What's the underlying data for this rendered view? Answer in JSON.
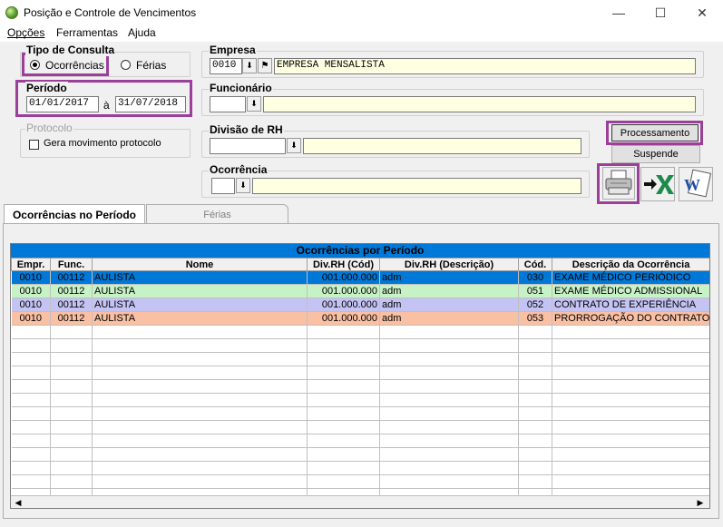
{
  "window": {
    "title": "Posição e Controle de Vencimentos"
  },
  "menu": {
    "items": [
      "Opções",
      "Ferramentas",
      "Ajuda"
    ]
  },
  "tipo_consulta": {
    "label": "Tipo de Consulta",
    "option1": "Ocorrências",
    "option2": "Férias",
    "selected": "Ocorrências"
  },
  "periodo": {
    "label": "Período",
    "from": "01/01/2017",
    "sep": "à",
    "to": "31/07/2018"
  },
  "protocolo": {
    "label": "Protocolo",
    "checkbox": "Gera movimento protocolo"
  },
  "empresa": {
    "label": "Empresa",
    "code": "0010",
    "name": "EMPRESA MENSALISTA"
  },
  "funcionario": {
    "label": "Funcionário",
    "code": "",
    "name": ""
  },
  "divisao": {
    "label": "Divisão de RH",
    "code": "",
    "name": ""
  },
  "ocorrencia": {
    "label": "Ocorrência",
    "code": "",
    "name": ""
  },
  "buttons": {
    "processamento": "Processamento",
    "suspende": "Suspende"
  },
  "tabs": {
    "tab1": "Ocorrências no Período",
    "tab2": "Férias"
  },
  "grid": {
    "title": "Ocorrências por Período",
    "headers": [
      "Empr.",
      "Func.",
      "Nome",
      "Div.RH (Cód)",
      "Div.RH (Descrição)",
      "Cód.",
      "Descrição da Ocorrência"
    ],
    "rows": [
      [
        "0010",
        "00112",
        "AULISTA",
        "001.000.000",
        "adm",
        "030",
        "EXAME MÉDICO PERIÓDICO"
      ],
      [
        "0010",
        "00112",
        "AULISTA",
        "001.000.000",
        "adm",
        "051",
        "EXAME MÉDICO ADMISSIONAL"
      ],
      [
        "0010",
        "00112",
        "AULISTA",
        "001.000.000",
        "adm",
        "052",
        "CONTRATO DE EXPERIÊNCIA"
      ],
      [
        "0010",
        "00112",
        "AULISTA",
        "001.000.000",
        "adm",
        "053",
        "PRORROGAÇÃO DO CONTRATO DE EXPERIÊNCIA"
      ]
    ],
    "row_colors": [
      "#0078d7",
      "#c6f2c6",
      "#c4c4f4",
      "#f9c0a4"
    ]
  }
}
